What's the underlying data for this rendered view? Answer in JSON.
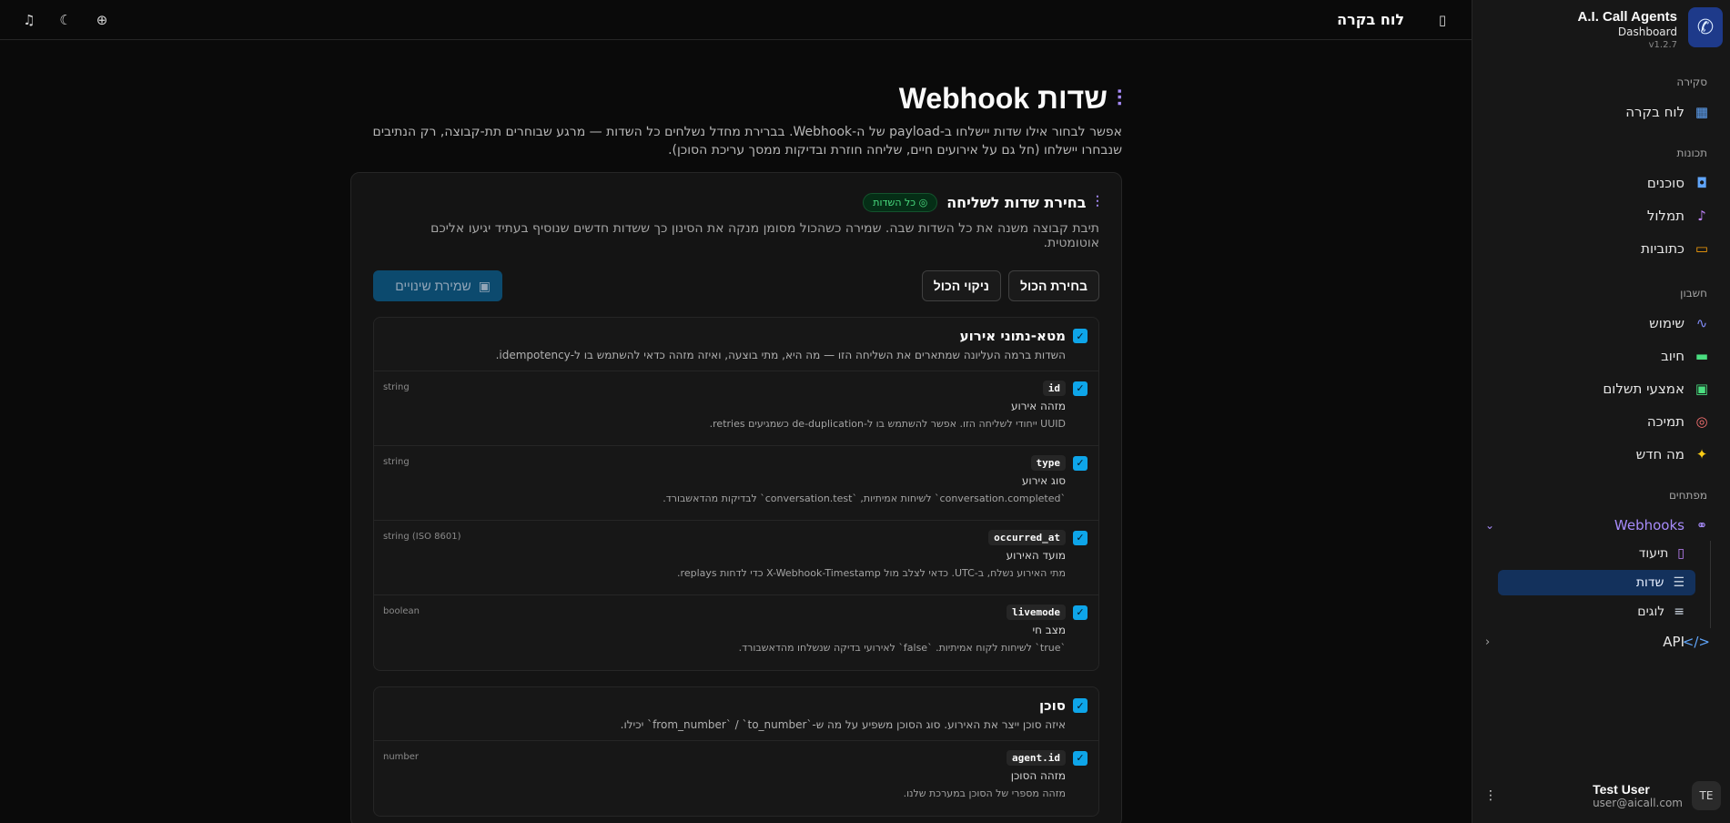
{
  "sidebar": {
    "app_title": "A.I. Call Agents",
    "app_subtitle": "Dashboard",
    "version": "v1.2.7",
    "sections": {
      "overview": "סקירה",
      "features": "תכונות",
      "account": "חשבון",
      "developers": "מפתחים"
    },
    "items": {
      "dashboard": "לוח בקרה",
      "agents": "סוכנים",
      "transcription": "תמלול",
      "transcripts": "כתוביות",
      "usage": "שימוש",
      "billing": "חיוב",
      "payment_methods": "אמצעי תשלום",
      "support": "תמיכה",
      "whats_new": "מה חדש",
      "webhooks": "Webhooks",
      "docs": "תיעוד",
      "fields": "שדות",
      "logs": "לוגים",
      "api": "API"
    },
    "user": {
      "name": "Test User",
      "email": "user@aicall.com",
      "initials": "TE"
    }
  },
  "topbar": {
    "title": "לוח בקרה"
  },
  "page": {
    "title": "שדות Webhook",
    "lead": "אפשר לבחור אילו שדות יישלחו ב-payload של ה-Webhook. בברירת מחדל נשלחים כל השדות — מרגע שבוחרים תת-קבוצה, רק הנתיבים שנבחרו יישלחו (חל גם על אירועים חיים, שליחה חוזרת ובדיקות ממסך עריכת הסוכן)."
  },
  "card": {
    "title": "בחירת שדות לשליחה",
    "badge": "כל השדות",
    "desc": "תיבת קבוצה משנה את כל השדות שבה. שמירה כשהכול מסומן מנקה את הסינון כך ששדות חדשים שנוסיף בעתיד יגיעו אליכם אוטומטית.",
    "select_all": "בחירת הכול",
    "clear_all": "ניקוי הכול",
    "save": "שמירת שינויים"
  },
  "groups": [
    {
      "title": "מטא-נתוני אירוע",
      "desc": "השדות ברמה העליונה שמתארים את השליחה הזו — מה היא, מתי בוצעה, ואיזה מזהה כדאי להשתמש בו ל-idempotency.",
      "fields": [
        {
          "key": "id",
          "label": "מזהה אירוע",
          "desc": "UUID ייחודי לשליחה הזו. אפשר להשתמש בו ל-de-duplication כשמגיעים retries.",
          "type": "string"
        },
        {
          "key": "type",
          "label": "סוג אירוע",
          "desc": "`conversation.completed` לשיחות אמיתיות, `conversation.test` לבדיקות מהדאשבורד.",
          "type": "string"
        },
        {
          "key": "occurred_at",
          "label": "מועד האירוע",
          "desc": "מתי האירוע נשלח, ב-UTC. כדאי לצלב מול X-Webhook-Timestamp כדי לדחות replays.",
          "type": "string (ISO 8601)"
        },
        {
          "key": "livemode",
          "label": "מצב חי",
          "desc": "`true` לשיחות לקוח אמיתיות. `false` לאירועי בדיקה שנשלחו מהדאשבורד.",
          "type": "boolean"
        }
      ]
    },
    {
      "title": "סוכן",
      "desc": "איזה סוכן ייצר את האירוע. סוג הסוכן משפיע על מה ש-`from_number` / `to_number` יכילו.",
      "fields": [
        {
          "key": "agent.id",
          "label": "מזהה הסוכן",
          "desc": "מזהה מספרי של הסוכן במערכת שלנו.",
          "type": "number"
        }
      ]
    }
  ]
}
